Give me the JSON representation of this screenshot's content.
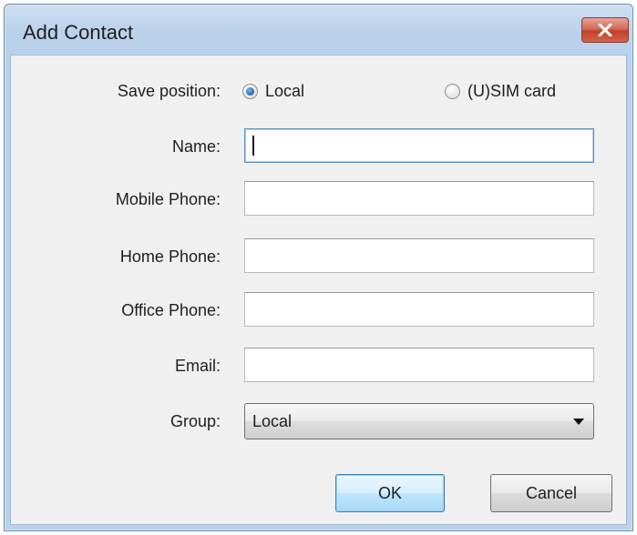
{
  "window": {
    "title": "Add Contact",
    "close_icon": "close-icon"
  },
  "form": {
    "save_position": {
      "label": "Save position:",
      "options": [
        {
          "label": "Local",
          "selected": true
        },
        {
          "label": "(U)SIM card",
          "selected": false
        }
      ]
    },
    "fields": [
      {
        "label": "Name:",
        "value": "",
        "focused": true
      },
      {
        "label": "Mobile Phone:",
        "value": "",
        "focused": false
      },
      {
        "label": "Home Phone:",
        "value": "",
        "focused": false
      },
      {
        "label": "Office Phone:",
        "value": "",
        "focused": false
      },
      {
        "label": "Email:",
        "value": "",
        "focused": false
      }
    ],
    "group": {
      "label": "Group:",
      "selected": "Local"
    }
  },
  "buttons": {
    "ok": "OK",
    "cancel": "Cancel"
  },
  "colors": {
    "title_bar": "#b9d1ea",
    "client_bg": "#f0f0f0",
    "close_button": "#c0412b",
    "focus_border": "#5c93c9",
    "radio_checked": "#2b6fc4"
  }
}
